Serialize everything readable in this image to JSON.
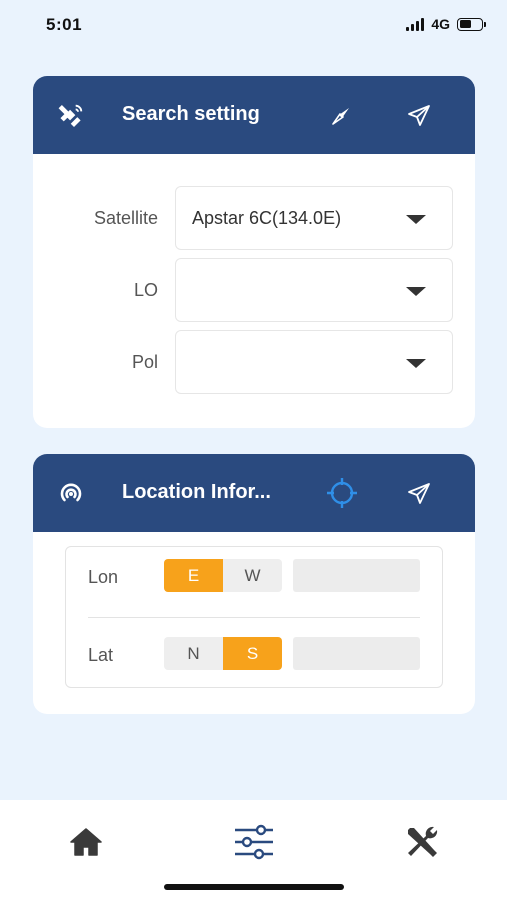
{
  "status_bar": {
    "time": "5:01",
    "network": "4G"
  },
  "search_card": {
    "title": "Search setting",
    "fields": [
      {
        "label": "Satellite",
        "value": "Apstar 6C(134.0E)"
      },
      {
        "label": "LO",
        "value": ""
      },
      {
        "label": "Pol",
        "value": ""
      }
    ]
  },
  "location_card": {
    "title": "Location Infor...",
    "lon": {
      "label": "Lon",
      "options": [
        "E",
        "W"
      ],
      "selected": "E",
      "value": ""
    },
    "lat": {
      "label": "Lat",
      "options": [
        "N",
        "S"
      ],
      "selected": "S",
      "value": ""
    }
  },
  "nav": {
    "items": [
      "home-icon",
      "sliders-icon",
      "tools-icon"
    ],
    "active": "sliders-icon"
  },
  "colors": {
    "header": "#2a4a7f",
    "accent": "#f7a21b",
    "background": "#eaf3fd",
    "locate_icon": "#2f8fe8"
  }
}
